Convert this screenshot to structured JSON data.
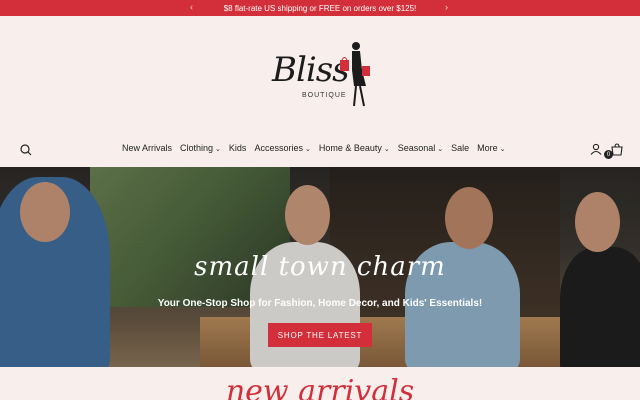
{
  "announcement": {
    "text": "$8 flat-rate US shipping or FREE on orders over $125!",
    "prev_icon": "‹",
    "next_icon": "›"
  },
  "logo": {
    "script": "Bliss",
    "sub": "BOUTIQUE"
  },
  "nav": {
    "items": [
      {
        "label": "New Arrivals",
        "dropdown": false
      },
      {
        "label": "Clothing",
        "dropdown": true
      },
      {
        "label": "Kids",
        "dropdown": false
      },
      {
        "label": "Accessories",
        "dropdown": true
      },
      {
        "label": "Home & Beauty",
        "dropdown": true
      },
      {
        "label": "Seasonal",
        "dropdown": true
      },
      {
        "label": "Sale",
        "dropdown": false
      },
      {
        "label": "More",
        "dropdown": true
      }
    ],
    "cart_count": "0"
  },
  "hero": {
    "tagline": "small town charm",
    "subline": "Your One-Stop Shop for Fashion, Home Decor, and Kids' Essentials!",
    "cta": "SHOP THE LATEST"
  },
  "section": {
    "title": "new arrivals"
  },
  "colors": {
    "brand_red": "#d32f3a",
    "background": "#f8efec"
  }
}
